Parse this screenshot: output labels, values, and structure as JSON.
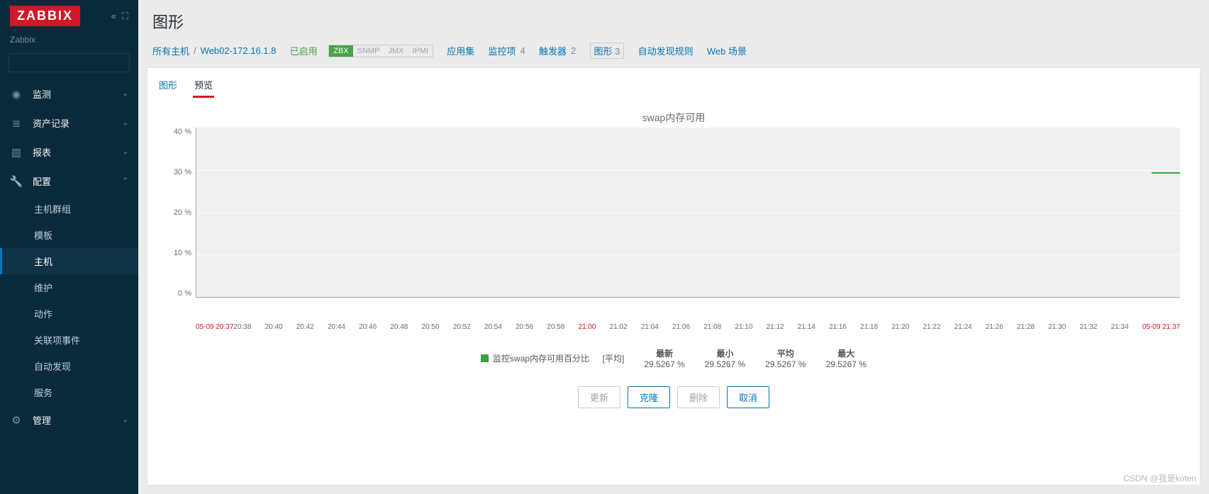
{
  "app": {
    "logo": "ZABBIX",
    "server": "Zabbix"
  },
  "sidebar": {
    "items": [
      {
        "icon": "◉",
        "label": "监测"
      },
      {
        "icon": "≣",
        "label": "资产记录"
      },
      {
        "icon": "▥",
        "label": "报表"
      },
      {
        "icon": "🔧",
        "label": "配置"
      },
      {
        "icon": "⚙",
        "label": "管理"
      }
    ],
    "config_sub": [
      "主机群组",
      "模板",
      "主机",
      "维护",
      "动作",
      "关联项事件",
      "自动发现",
      "服务"
    ]
  },
  "header": {
    "title": "图形"
  },
  "breadcrumb": {
    "all_hosts": "所有主机",
    "host": "Web02-172.16.1.8",
    "enabled": "已启用",
    "proto": {
      "zbx": "ZBX",
      "snmp": "SNMP",
      "jmx": "JMX",
      "ipmi": "IPMI"
    },
    "apps": "应用集",
    "items": "监控项",
    "items_n": "4",
    "triggers": "触发器",
    "triggers_n": "2",
    "graphs": "图形",
    "graphs_n": "3",
    "discovery": "自动发现规则",
    "web": "Web 场景"
  },
  "tabs": {
    "graph": "图形",
    "preview": "预览"
  },
  "chart_data": {
    "type": "line",
    "title": "swap内存可用",
    "ylabel": "",
    "xlabel": "",
    "ylim": [
      0,
      40
    ],
    "y_ticks": [
      "40 %",
      "30 %",
      "20 %",
      "10 %",
      "0 %"
    ],
    "x_ticks": [
      "05-09 20:37",
      "20:38",
      "20:40",
      "20:42",
      "20:44",
      "20:46",
      "20:48",
      "20:50",
      "20:52",
      "20:54",
      "20:56",
      "20:58",
      "21:00",
      "21:02",
      "21:04",
      "21:06",
      "21:08",
      "21:10",
      "21:12",
      "21:14",
      "21:16",
      "21:18",
      "21:20",
      "21:22",
      "21:24",
      "21:26",
      "21:28",
      "21:30",
      "21:32",
      "21:34",
      "05-09 21:37"
    ],
    "series": [
      {
        "name": "监控swap内存可用百分比",
        "mode": "[平均]",
        "color": "#3aa23a",
        "values": [
          29.5267
        ]
      }
    ],
    "legend_cols": {
      "latest": "最新",
      "min": "最小",
      "avg": "平均",
      "max": "最大"
    },
    "stats": {
      "latest": "29.5267 %",
      "min": "29.5267 %",
      "avg": "29.5267 %",
      "max": "29.5267 %"
    }
  },
  "buttons": {
    "update": "更新",
    "clone": "克隆",
    "delete": "删除",
    "cancel": "取消"
  },
  "watermark": "CSDN @我是koten"
}
